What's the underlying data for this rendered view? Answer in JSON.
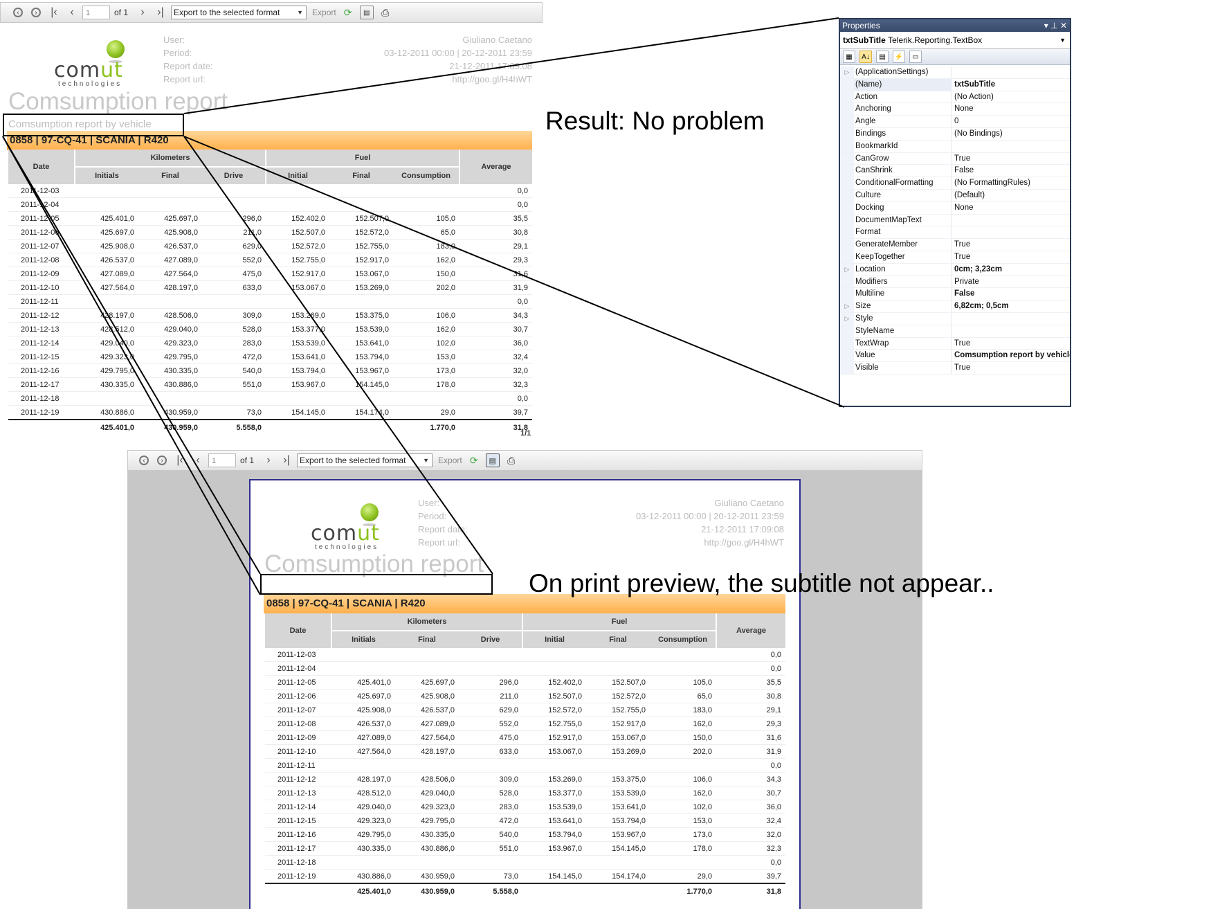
{
  "toolbar": {
    "page_value": "1",
    "of_pages": "of 1",
    "export_format": "Export to the selected format",
    "export_label": "Export"
  },
  "report": {
    "logo_word_a": "com",
    "logo_word_b": "ut",
    "logo_tagline": "technologies",
    "meta": [
      {
        "label": "User:",
        "value": "Giuliano Caetano"
      },
      {
        "label": "Period:",
        "value": "03-12-2011 00:00  |  20-12-2011 23:59"
      },
      {
        "label": "Report date:",
        "value": "21-12-2011 17:09:08"
      },
      {
        "label": "Report url:",
        "value": "http://goo.gl/H4hWT"
      }
    ],
    "title": "Comsumption report",
    "subtitle": "Comsumption report by vehicle",
    "vehicle_band": "0858  |  97-CQ-41  |  SCANIA  |  R420",
    "headers": {
      "date": "Date",
      "km_group": "Kilometers",
      "fuel_group": "Fuel",
      "average": "Average",
      "km_initial": "Initials",
      "km_final": "Final",
      "km_drive": "Drive",
      "fuel_initial": "Initial",
      "fuel_final": "Final",
      "fuel_consumption": "Consumption"
    },
    "rows": [
      [
        "2011-12-03",
        "",
        "",
        "",
        "",
        "",
        "",
        "0,0"
      ],
      [
        "2011-12-04",
        "",
        "",
        "",
        "",
        "",
        "",
        "0,0"
      ],
      [
        "2011-12-05",
        "425.401,0",
        "425.697,0",
        "296,0",
        "152.402,0",
        "152.507,0",
        "105,0",
        "35,5"
      ],
      [
        "2011-12-06",
        "425.697,0",
        "425.908,0",
        "211,0",
        "152.507,0",
        "152.572,0",
        "65,0",
        "30,8"
      ],
      [
        "2011-12-07",
        "425.908,0",
        "426.537,0",
        "629,0",
        "152.572,0",
        "152.755,0",
        "183,0",
        "29,1"
      ],
      [
        "2011-12-08",
        "426.537,0",
        "427.089,0",
        "552,0",
        "152.755,0",
        "152.917,0",
        "162,0",
        "29,3"
      ],
      [
        "2011-12-09",
        "427.089,0",
        "427.564,0",
        "475,0",
        "152.917,0",
        "153.067,0",
        "150,0",
        "31,6"
      ],
      [
        "2011-12-10",
        "427.564,0",
        "428.197,0",
        "633,0",
        "153.067,0",
        "153.269,0",
        "202,0",
        "31,9"
      ],
      [
        "2011-12-11",
        "",
        "",
        "",
        "",
        "",
        "",
        "0,0"
      ],
      [
        "2011-12-12",
        "428.197,0",
        "428.506,0",
        "309,0",
        "153.269,0",
        "153.375,0",
        "106,0",
        "34,3"
      ],
      [
        "2011-12-13",
        "428.512,0",
        "429.040,0",
        "528,0",
        "153.377,0",
        "153.539,0",
        "162,0",
        "30,7"
      ],
      [
        "2011-12-14",
        "429.040,0",
        "429.323,0",
        "283,0",
        "153.539,0",
        "153.641,0",
        "102,0",
        "36,0"
      ],
      [
        "2011-12-15",
        "429.323,0",
        "429.795,0",
        "472,0",
        "153.641,0",
        "153.794,0",
        "153,0",
        "32,4"
      ],
      [
        "2011-12-16",
        "429.795,0",
        "430.335,0",
        "540,0",
        "153.794,0",
        "153.967,0",
        "173,0",
        "32,0"
      ],
      [
        "2011-12-17",
        "430.335,0",
        "430.886,0",
        "551,0",
        "153.967,0",
        "154.145,0",
        "178,0",
        "32,3"
      ],
      [
        "2011-12-18",
        "",
        "",
        "",
        "",
        "",
        "",
        "0,0"
      ],
      [
        "2011-12-19",
        "430.886,0",
        "430.959,0",
        "73,0",
        "154.145,0",
        "154.174,0",
        "29,0",
        "39,7"
      ]
    ],
    "totals": [
      "",
      "425.401,0",
      "430.959,0",
      "5.558,0",
      "",
      "",
      "1.770,0",
      "31,8"
    ],
    "page_indicator": "1/1"
  },
  "properties": {
    "title": "Properties",
    "selected": "txtSubTitle",
    "selected_type": "Telerik.Reporting.TextBox",
    "rows": [
      {
        "name": "(ApplicationSettings)",
        "value": "",
        "expand": true,
        "bold": false
      },
      {
        "name": "(Name)",
        "value": "txtSubTitle",
        "expand": false,
        "bold": true
      },
      {
        "name": "Action",
        "value": "(No Action)",
        "expand": false,
        "bold": false
      },
      {
        "name": "Anchoring",
        "value": "None",
        "expand": false,
        "bold": false
      },
      {
        "name": "Angle",
        "value": "0",
        "expand": false,
        "bold": false
      },
      {
        "name": "Bindings",
        "value": "(No Bindings)",
        "expand": false,
        "bold": false
      },
      {
        "name": "BookmarkId",
        "value": "",
        "expand": false,
        "bold": false
      },
      {
        "name": "CanGrow",
        "value": "True",
        "expand": false,
        "bold": false
      },
      {
        "name": "CanShrink",
        "value": "False",
        "expand": false,
        "bold": false
      },
      {
        "name": "ConditionalFormatting",
        "value": "(No FormattingRules)",
        "expand": false,
        "bold": false
      },
      {
        "name": "Culture",
        "value": "(Default)",
        "expand": false,
        "bold": false
      },
      {
        "name": "Docking",
        "value": "None",
        "expand": false,
        "bold": false
      },
      {
        "name": "DocumentMapText",
        "value": "",
        "expand": false,
        "bold": false
      },
      {
        "name": "Format",
        "value": "",
        "expand": false,
        "bold": false
      },
      {
        "name": "GenerateMember",
        "value": "True",
        "expand": false,
        "bold": false
      },
      {
        "name": "KeepTogether",
        "value": "True",
        "expand": false,
        "bold": false
      },
      {
        "name": "Location",
        "value": "0cm; 3,23cm",
        "expand": true,
        "bold": true
      },
      {
        "name": "Modifiers",
        "value": "Private",
        "expand": false,
        "bold": false
      },
      {
        "name": "Multiline",
        "value": "False",
        "expand": false,
        "bold": true
      },
      {
        "name": "Size",
        "value": "6,82cm; 0,5cm",
        "expand": true,
        "bold": true
      },
      {
        "name": "Style",
        "value": "",
        "expand": true,
        "bold": false
      },
      {
        "name": "StyleName",
        "value": "",
        "expand": false,
        "bold": false
      },
      {
        "name": "TextWrap",
        "value": "True",
        "expand": false,
        "bold": false
      },
      {
        "name": "Value",
        "value": "Comsumption report by vehicle",
        "expand": false,
        "bold": true
      },
      {
        "name": "Visible",
        "value": "True",
        "expand": false,
        "bold": false
      }
    ]
  },
  "annotations": {
    "result": "Result: No problem",
    "print_preview": "On print preview, the subtitle not appear.."
  }
}
